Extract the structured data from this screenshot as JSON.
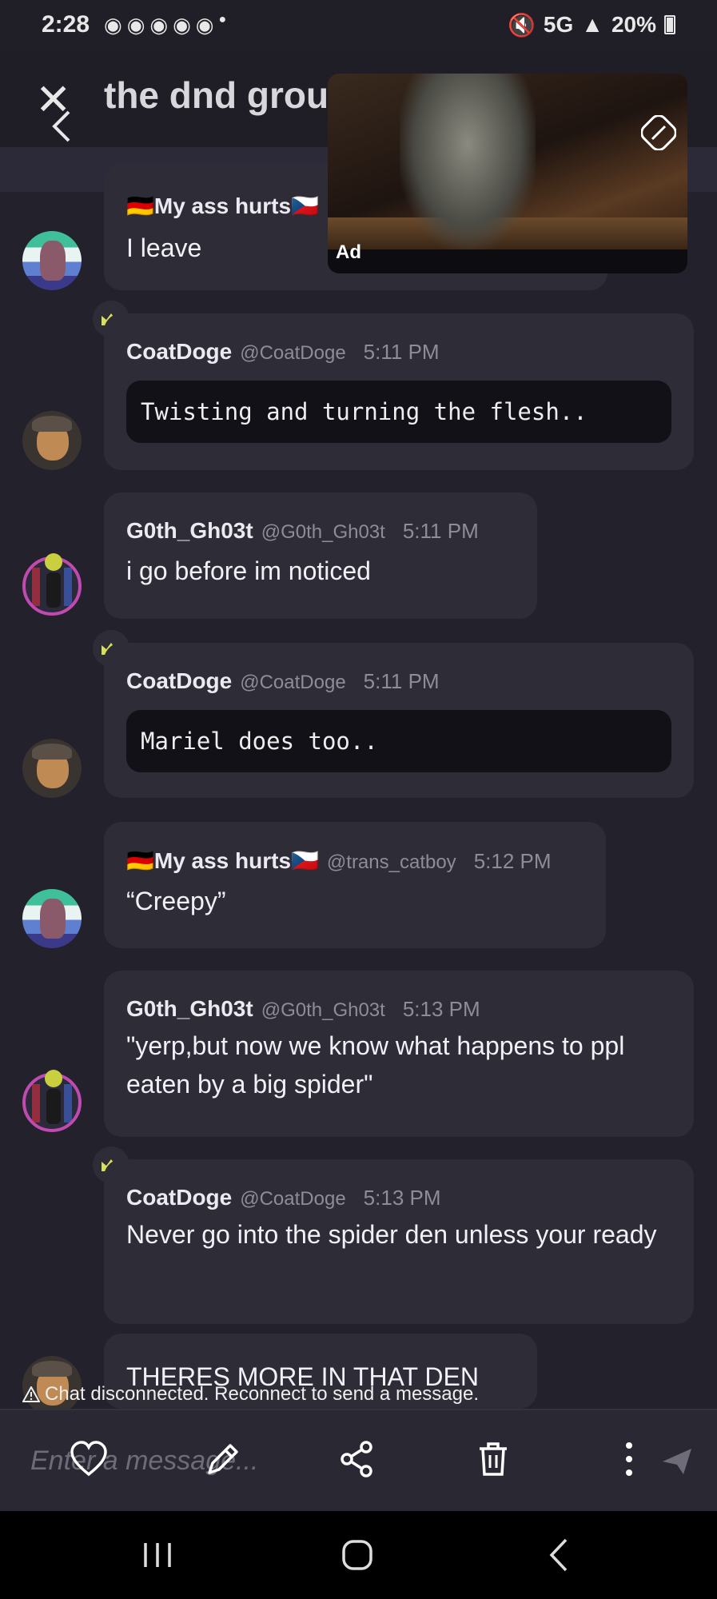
{
  "status_bar": {
    "time": "2:28",
    "battery": "20%",
    "network": "5G"
  },
  "header": {
    "title": "the dnd group"
  },
  "ad": {
    "label": "Ad"
  },
  "messages": [
    {
      "author": "🇩🇪My ass hurts🇨🇿",
      "handle": "",
      "time": "",
      "text": "I leave",
      "avatar": "cat"
    },
    {
      "author": "CoatDoge",
      "handle": "@CoatDoge",
      "time": "5:11 PM",
      "code": "Twisting and turning the flesh..",
      "avatar": "dog",
      "crown": true
    },
    {
      "author": "G0th_Gh03t",
      "handle": "@G0th_Gh03t",
      "time": "5:11 PM",
      "text": "i go before im noticed",
      "avatar": "goth"
    },
    {
      "author": "CoatDoge",
      "handle": "@CoatDoge",
      "time": "5:11 PM",
      "code": "Mariel does too..",
      "avatar": "dog",
      "crown": true
    },
    {
      "author": "🇩🇪My ass hurts🇨🇿",
      "handle": "@trans_catboy",
      "time": "5:12 PM",
      "text": "“Creepy”",
      "avatar": "cat"
    },
    {
      "author": "G0th_Gh03t",
      "handle": "@G0th_Gh03t",
      "time": "5:13 PM",
      "text": "\"yerp,but now we know what happens to ppl eaten by a big spider\"",
      "avatar": "goth"
    },
    {
      "author": "CoatDoge",
      "handle": "@CoatDoge",
      "time": "5:13 PM",
      "text": "Never go into the spider den unless your ready",
      "avatar": "dog",
      "crown": true
    },
    {
      "author": "",
      "handle": "",
      "time": "",
      "text": "THERES MORE IN THAT DEN",
      "avatar": "dog"
    }
  ],
  "disconnected_notice": "Chat disconnected. Reconnect to send a message.",
  "input": {
    "placeholder": "Enter a message..."
  },
  "icons": {
    "close": "close-icon",
    "back": "chevron-left-icon",
    "crown": "crown-icon",
    "heart": "heart-icon",
    "edit": "pencil-icon",
    "share": "share-icon",
    "delete": "trash-icon",
    "more": "more-vertical-icon",
    "send": "send-icon",
    "warning": "warning-icon"
  },
  "colors": {
    "background": "#23212c",
    "bubble": "#2e2c37",
    "code_block": "#121118",
    "crown": "#d8e05a",
    "muted_text": "#8e8c98"
  }
}
